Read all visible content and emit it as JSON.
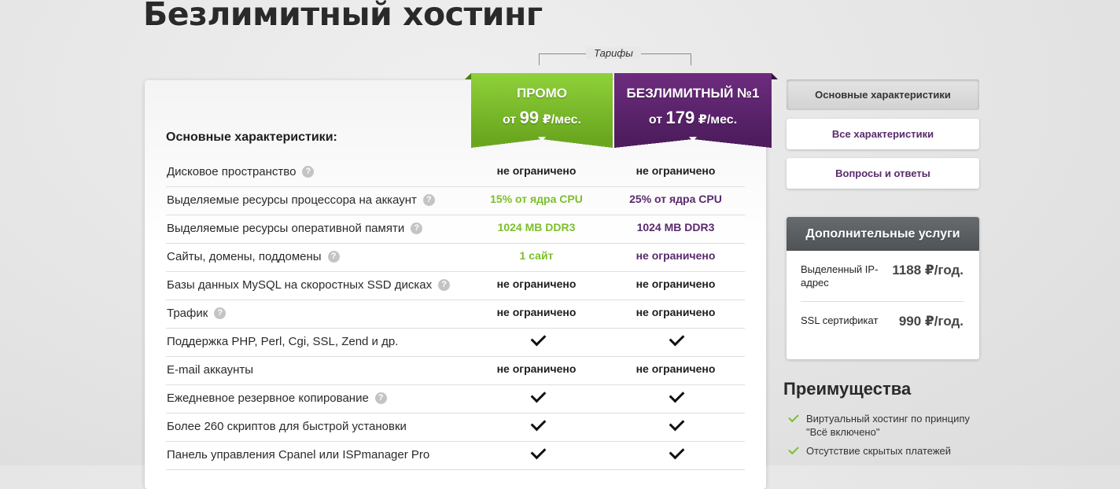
{
  "page": {
    "title": "Безлимитный хостинг"
  },
  "tariffs_label": "Тарифы",
  "main": {
    "heading": "Основные характеристики:"
  },
  "plans": [
    {
      "name": "ПРОМО",
      "price_prefix": "от",
      "price_amount": "99",
      "price_suffix": "₽/мес.",
      "color": "#7cbf2b"
    },
    {
      "name": "БЕЗЛИМИТНЫЙ №1",
      "price_prefix": "от",
      "price_amount": "179",
      "price_suffix": "₽/мес.",
      "color": "#5a2a6c"
    }
  ],
  "specs": [
    {
      "label": "Дисковое пространство",
      "help": "?",
      "promo": "не ограничено",
      "unlim": "не ограничено"
    },
    {
      "label": "Выделяемые ресурсы процессора на аккаунт",
      "help": "?",
      "promo": "15% от ядра CPU",
      "unlim": "25% от ядра CPU"
    },
    {
      "label": "Выделяемые ресурсы оперативной памяти",
      "help": "?",
      "promo": "1024 MB DDR3",
      "unlim": "1024 MB DDR3"
    },
    {
      "label": "Сайты, домены, поддомены",
      "help": "?",
      "promo": "1 сайт",
      "unlim": "не ограничено"
    },
    {
      "label": "Базы данных MySQL на скоростных SSD дисках",
      "help": "?",
      "promo": "не ограничено",
      "unlim": "не ограничено"
    },
    {
      "label": "Трафик",
      "help": "?",
      "promo": "не ограничено",
      "unlim": "не ограничено"
    },
    {
      "label": "Поддержка PHP, Perl, Cgi, SSL, Zend и др.",
      "promo": true,
      "unlim": true
    },
    {
      "label": "E-mail аккаунты",
      "promo": "не ограничено",
      "unlim": "не ограничено"
    },
    {
      "label": "Ежедневное резервное копирование",
      "help": "?",
      "promo": true,
      "unlim": true
    },
    {
      "label": "Более 260 скриптов для быстрой установки",
      "promo": true,
      "unlim": true
    },
    {
      "label": "Панель управления Cpanel или ISPmanager Pro",
      "promo": true,
      "unlim": true
    }
  ],
  "sidebar": {
    "buttons": [
      {
        "label": "Основные характеристики",
        "active": true
      },
      {
        "label": "Все характеристики",
        "active": false
      },
      {
        "label": "Вопросы и ответы",
        "active": false
      }
    ]
  },
  "services": {
    "title": "Дополнительные услуги",
    "items": [
      {
        "name": "Выделенный IP-адрес",
        "price": "1188 ₽/год."
      },
      {
        "name": "SSL сертификат",
        "price": "990 ₽/год."
      }
    ]
  },
  "advantages": {
    "title": "Преимущества",
    "items": [
      "Виртуальный хостинг по принципу \"Всё включено\"",
      "Отсутствие скрытых платежей"
    ]
  }
}
